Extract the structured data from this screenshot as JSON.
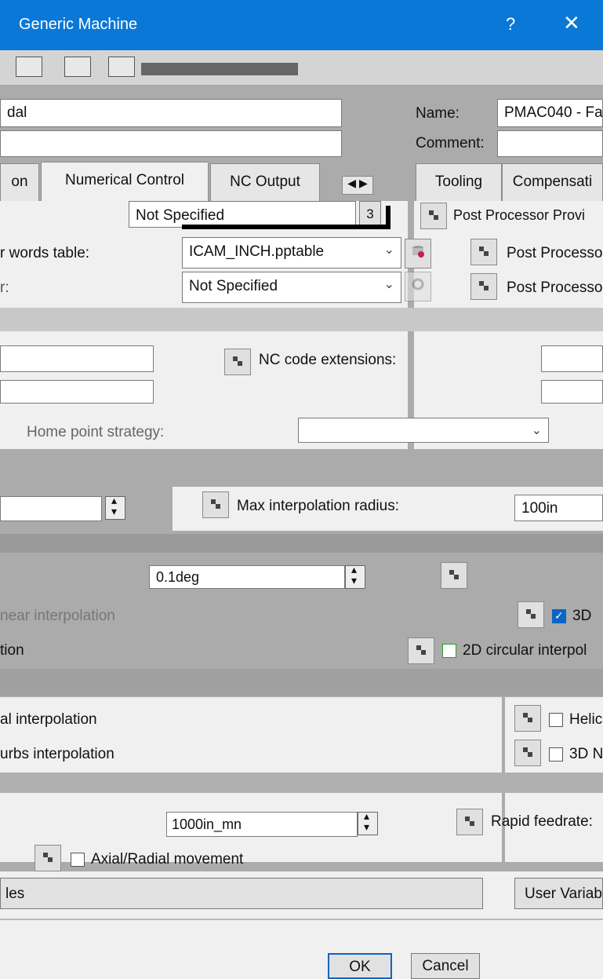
{
  "window": {
    "title": "Generic Machine",
    "help": "?",
    "close": "✕"
  },
  "header": {
    "left_name_value": "dal",
    "name_label": "Name:",
    "name_value": "PMAC040 - Fa",
    "comment_label": "Comment:",
    "comment_value": ""
  },
  "left_tabs": {
    "partial": "on",
    "numerical_control": "Numerical Control",
    "nc_output": "NC Output"
  },
  "right_tabs": {
    "tooling": "Tooling",
    "compensation": "Compensati"
  },
  "rows": {
    "words_table_label": "r words table:",
    "words_table_value": "ICAM_INCH.pptable",
    "r_label": "r:",
    "not_specified_value": "Not Specified",
    "top_select_value": "Not Specified",
    "post_proc_provider": "Post Processor Provi",
    "post_proc_1": "Post Processo",
    "post_proc_2": "Post Processo",
    "nc_code_extensions": "NC code extensions:",
    "home_point": "Home point strategy:",
    "max_interp_label": "Max interpolation radius:",
    "max_interp_value": "100in",
    "angle_value": "0.1deg",
    "linear_interp": "near interpolation",
    "tion": "tion",
    "circ_2d": "2D circular interpol",
    "d3": "3D",
    "al_interp": "al interpolation",
    "urbs_interp": "urbs interpolation",
    "helic": "Helic",
    "nurbs_3d": "3D N",
    "feedrate_value": "1000in_mn",
    "rapid_feedrate": "Rapid feedrate:",
    "axial_radial": "Axial/Radial movement"
  },
  "bottom": {
    "les": "les",
    "user_vars": "User Variab",
    "ok": "OK",
    "cancel": "Cancel"
  }
}
